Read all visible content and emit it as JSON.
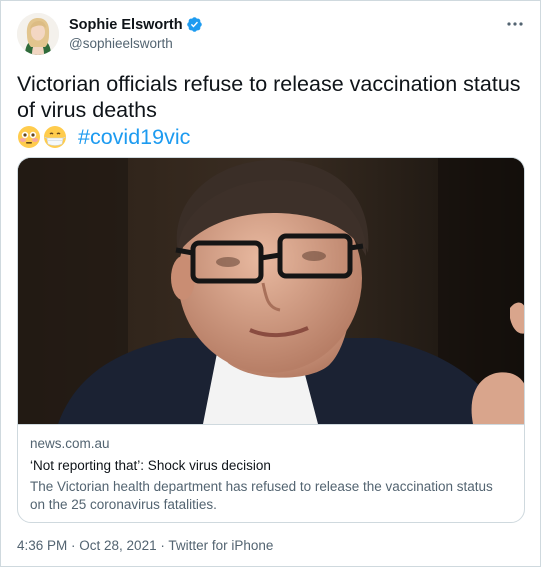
{
  "user": {
    "display_name": "Sophie Elsworth",
    "handle": "@sophieelsworth",
    "verified": true
  },
  "icons": {
    "verified": "verified-badge-icon",
    "more": "more-options-icon",
    "emoji_1": "flushed-face-emoji",
    "emoji_2": "face-with-medical-mask-emoji"
  },
  "tweet": {
    "text_line_1": "Victorian officials refuse to release vaccination status",
    "text_line_2": "of virus deaths",
    "hashtag": "#covid19vic"
  },
  "card": {
    "domain": "news.com.au",
    "title": "‘Not reporting that’: Shock virus decision",
    "description_line_1": "The Victorian health department has refused to release the vaccination status",
    "description_line_2": "on the 25 coronavirus fatalities."
  },
  "meta": {
    "time": "4:36 PM",
    "separator_1": " · ",
    "date": "Oct 28, 2021",
    "separator_2": " · ",
    "source": "Twitter for iPhone"
  },
  "colors": {
    "accent": "#1d9bf0",
    "text_primary": "#0f1419",
    "text_secondary": "#536471",
    "border": "#cfd9de"
  }
}
